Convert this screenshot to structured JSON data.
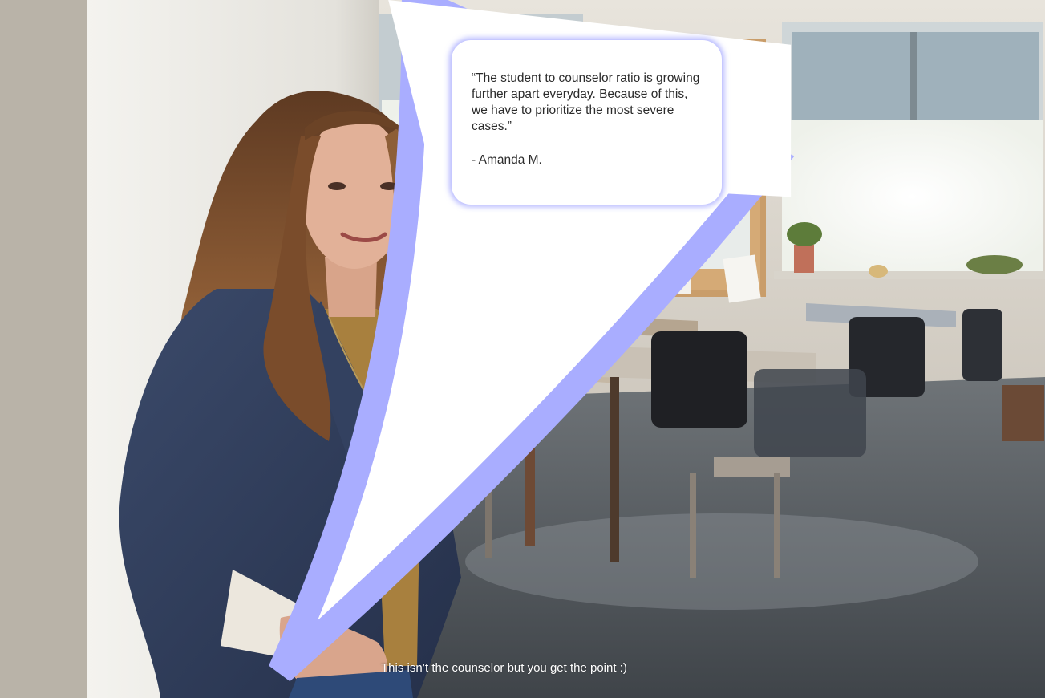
{
  "speech_bubble": {
    "quote": "“The student to counselor ratio is growing further apart everyday. Because of this, we have to prioritize the most severe cases.”",
    "author": "- Amanda M."
  },
  "caption": "This isn’t the counselor but you get the point :)",
  "colors": {
    "bubble_glow": "#7b80ff",
    "bubble_fill": "#ffffff",
    "quote_text": "#2b2b2b",
    "caption_text": "#ffffff"
  }
}
